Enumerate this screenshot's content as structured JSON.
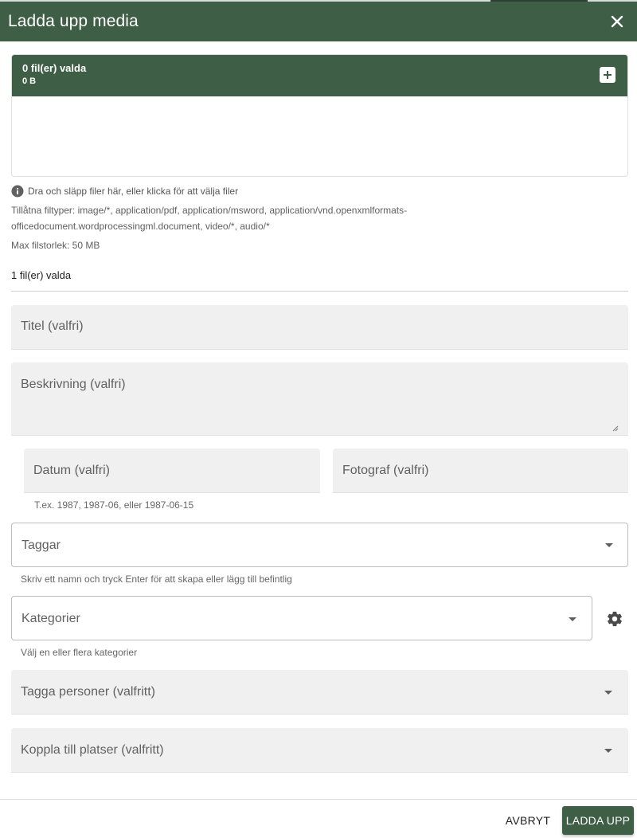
{
  "dialog": {
    "title": "Ladda upp media"
  },
  "dropzone": {
    "count_label": "0 fil(er) valda",
    "size_label": "0 B",
    "info_text": "Dra och släpp filer här, eller klicka för att välja filer",
    "allowed_types": "Tillåtna filtyper: image/*, application/pdf, application/msword, application/vnd.openxmlformats-officedocument.wordprocessingml.document, video/*, audio/*",
    "max_size": "Max filstorlek: 50 MB"
  },
  "selected": {
    "label": "1 fil(er) valda"
  },
  "form": {
    "title_label": "Titel (valfri)",
    "description_label": "Beskrivning (valfri)",
    "date_label": "Datum (valfri)",
    "date_hint": "T.ex. 1987, 1987-06, eller 1987-06-15",
    "photographer_label": "Fotograf (valfri)",
    "tags_label": "Taggar",
    "tags_hint": "Skriv ett namn och tryck Enter för att skapa eller lägg till befintlig",
    "categories_label": "Kategorier",
    "categories_hint": "Välj en eller flera kategorier",
    "people_label": "Tagga personer (valfritt)",
    "places_label": "Koppla till platser (valfritt)"
  },
  "footer": {
    "cancel_label": "AVBRYT",
    "upload_label": "LADDA UPP"
  },
  "icons": {
    "close": "close-icon",
    "add": "plus-icon",
    "info": "info-icon",
    "settings": "gear-icon",
    "dropdown": "chevron-down-icon"
  },
  "colors": {
    "accent": "#3f5e46",
    "field_bg": "#f0f0f0"
  }
}
